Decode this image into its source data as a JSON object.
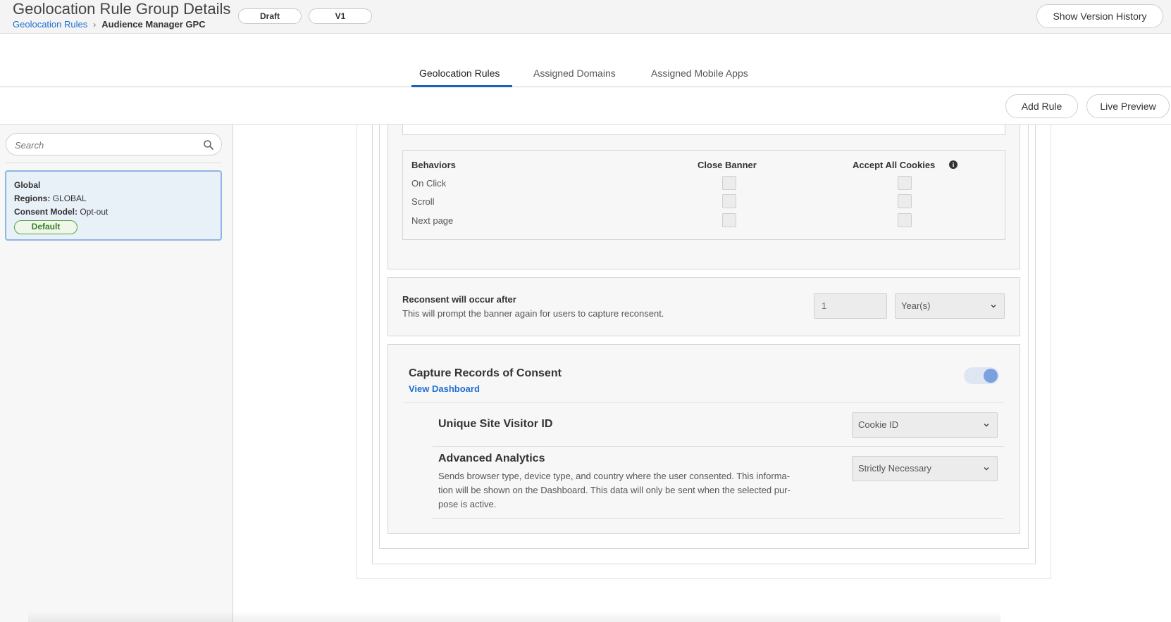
{
  "header": {
    "title": "Geolocation Rule Group Details",
    "breadcrumb": {
      "link": "Geolocation Rules",
      "separator": "›",
      "current": "Audience Manager GPC"
    },
    "status_pill": "Draft",
    "version_pill": "V1",
    "history_button": "Show Version History"
  },
  "tabs": [
    {
      "label": "Geolocation Rules",
      "active": true
    },
    {
      "label": "Assigned Domains",
      "active": false
    },
    {
      "label": "Assigned Mobile Apps",
      "active": false
    }
  ],
  "toolbar": {
    "add_rule": "Add Rule",
    "live_preview": "Live Preview"
  },
  "sidebar": {
    "search_placeholder": "Search",
    "rule": {
      "name": "Global",
      "regions_label": "Regions:",
      "regions_value": "GLOBAL",
      "consent_label": "Consent Model:",
      "consent_value": "Opt-out",
      "badge": "Default"
    }
  },
  "behaviors": {
    "header": "Behaviors",
    "col_close": "Close Banner",
    "col_accept": "Accept All Cookies",
    "rows": [
      "On Click",
      "Scroll",
      "Next page"
    ]
  },
  "reconsent": {
    "title": "Reconsent will occur after",
    "description": "This will prompt the banner again for users to capture reconsent.",
    "value": "1",
    "unit": "Year(s)"
  },
  "consent": {
    "title": "Capture Records of Consent",
    "dashboard_link": "View Dashboard",
    "enabled": true,
    "visitor_id_label": "Unique Site Visitor ID",
    "visitor_id_value": "Cookie ID",
    "analytics_label": "Advanced Analytics",
    "analytics_desc_1": "Sends browser type, device type, and country where the user consented. This informa-",
    "analytics_desc_2": "tion will be shown on the Dashboard. This data will only be sent when the selected pur-",
    "analytics_desc_3": "pose is active.",
    "analytics_value": "Strictly Necessary"
  },
  "colors": {
    "accent": "#1f6fd1",
    "tab_underline": "#1f5fbf",
    "badge_green": "#5aa046",
    "toggle_knob": "#7aa0e0"
  }
}
